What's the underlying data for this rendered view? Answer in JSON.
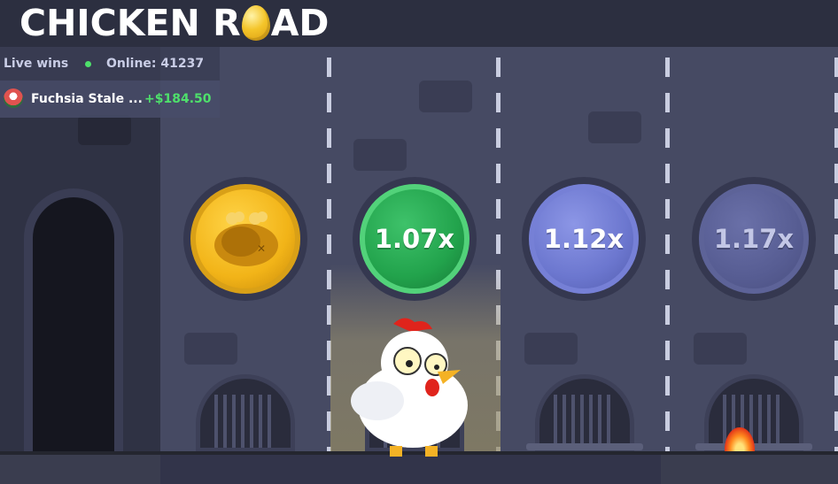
{
  "header": {
    "logo_left": "CHICKEN R",
    "logo_right": "AD"
  },
  "live_panel": {
    "title": "Live wins",
    "online_label": "Online: 41237",
    "winner_name": "Fuchsia Stale ...",
    "winner_amount": "+$184.50"
  },
  "lanes": [
    {
      "state": "passed",
      "icon": "roasted-chicken-icon",
      "multiplier": ""
    },
    {
      "state": "current",
      "multiplier": "1.07x",
      "color": "#22a34c"
    },
    {
      "state": "next",
      "multiplier": "1.12x",
      "color": "#6c77cf"
    },
    {
      "state": "upcoming",
      "multiplier": "1.17x",
      "color": "#575d93"
    }
  ],
  "colors": {
    "win_green": "#4ee06b",
    "coin_gold": "#f2b418",
    "background": "#464a63",
    "topbar": "#2c2f40"
  }
}
